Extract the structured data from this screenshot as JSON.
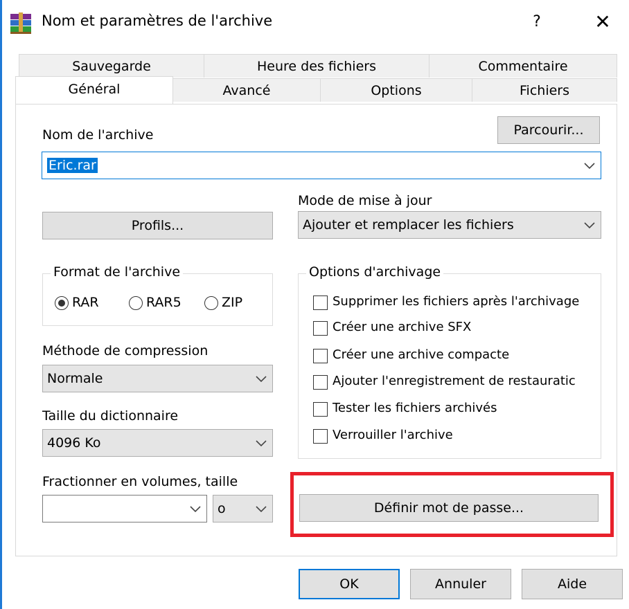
{
  "window": {
    "title": "Nom et paramètres de l'archive",
    "help": "?",
    "close": "✕"
  },
  "tabs": {
    "row1": [
      "Sauvegarde",
      "Heure des fichiers",
      "Commentaire"
    ],
    "row2": [
      "Général",
      "Avancé",
      "Options",
      "Fichiers"
    ],
    "active": "Général"
  },
  "archive_name": {
    "label": "Nom de l'archive",
    "value": "Eric.rar",
    "browse_label": "Parcourir..."
  },
  "update_mode": {
    "label": "Mode de mise à jour",
    "value": "Ajouter et remplacer les fichiers"
  },
  "profiles_label": "Profils...",
  "archive_format": {
    "title": "Format de l'archive",
    "options": [
      "RAR",
      "RAR5",
      "ZIP"
    ],
    "selected": "RAR"
  },
  "compression": {
    "label": "Méthode de compression",
    "value": "Normale"
  },
  "dictionary": {
    "label": "Taille du dictionnaire",
    "value": "4096 Ko"
  },
  "split": {
    "label": "Fractionner en volumes, taille",
    "value": "",
    "unit": "o"
  },
  "archiving_options": {
    "title": "Options d'archivage",
    "items": [
      {
        "label": "Supprimer les fichiers après l'archivage",
        "checked": false
      },
      {
        "label": "Créer une archive SFX",
        "checked": false
      },
      {
        "label": "Créer une archive compacte",
        "checked": false
      },
      {
        "label": "Ajouter l'enregistrement de restauratic",
        "checked": false
      },
      {
        "label": "Tester les fichiers archivés",
        "checked": false
      },
      {
        "label": "Verrouiller l'archive",
        "checked": false
      }
    ]
  },
  "password_label": "Définir mot de passe...",
  "footer": {
    "ok": "OK",
    "cancel": "Annuler",
    "help": "Aide"
  },
  "colors": {
    "highlight": "#e8212b",
    "selection": "#0078d7",
    "ok_border": "#0078d7"
  }
}
